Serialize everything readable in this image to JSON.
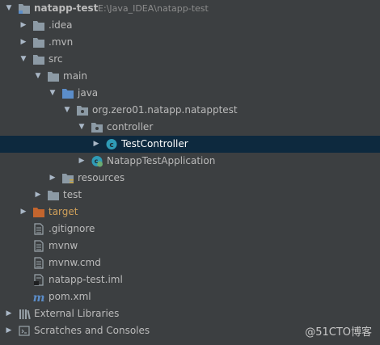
{
  "project": {
    "name": "natapp-test",
    "path": "E:\\Java_IDEA\\natapp-test"
  },
  "tree": {
    "idea": ".idea",
    "mvn": ".mvn",
    "src": "src",
    "main": "main",
    "java": "java",
    "package": "org.zero01.natapp.natapptest",
    "controller": "controller",
    "test_controller": "TestController",
    "application": "NatappTestApplication",
    "resources": "resources",
    "test": "test",
    "target": "target",
    "gitignore": ".gitignore",
    "mvnw": "mvnw",
    "mvnw_cmd": "mvnw.cmd",
    "iml": "natapp-test.iml",
    "pom": "pom.xml",
    "external_libraries": "External Libraries",
    "scratches": "Scratches and Consoles"
  },
  "watermark": "@51CTO博客",
  "colors": {
    "background": "#3c3f41",
    "selection": "#0d293e",
    "folder": "#8c9aa5",
    "source_folder": "#5b8dc9",
    "excluded_folder": "#c3652e",
    "class_icon": "#2f9bb6"
  }
}
